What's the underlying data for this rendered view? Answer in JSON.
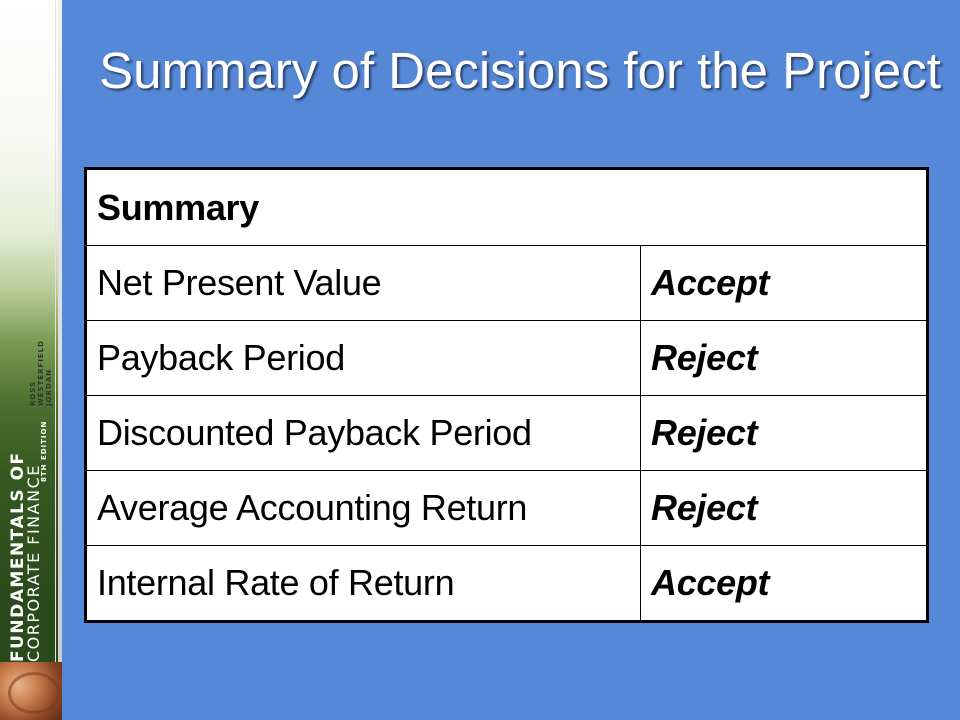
{
  "slide": {
    "title": "Summary of Decisions for the Project"
  },
  "spine": {
    "brand_bold": "FUNDAMENTALS OF",
    "brand_light": "CORPORATE FINANCE",
    "authors": [
      "ROSS",
      "WESTERFIELD",
      "JORDAN"
    ],
    "edition": "8TH EDITION"
  },
  "table": {
    "header": "Summary",
    "rows": [
      {
        "criterion": "Net Present Value",
        "decision": "Accept"
      },
      {
        "criterion": "Payback Period",
        "decision": "Reject"
      },
      {
        "criterion": "Discounted Payback Period",
        "decision": "Reject"
      },
      {
        "criterion": "Average Accounting Return",
        "decision": "Reject"
      },
      {
        "criterion": "Internal Rate of Return",
        "decision": "Accept"
      }
    ]
  },
  "colors": {
    "background": "#5588d6",
    "title_text": "#ffffff",
    "table_background": "#ffffff",
    "spine_green": "#2b4a1b"
  }
}
